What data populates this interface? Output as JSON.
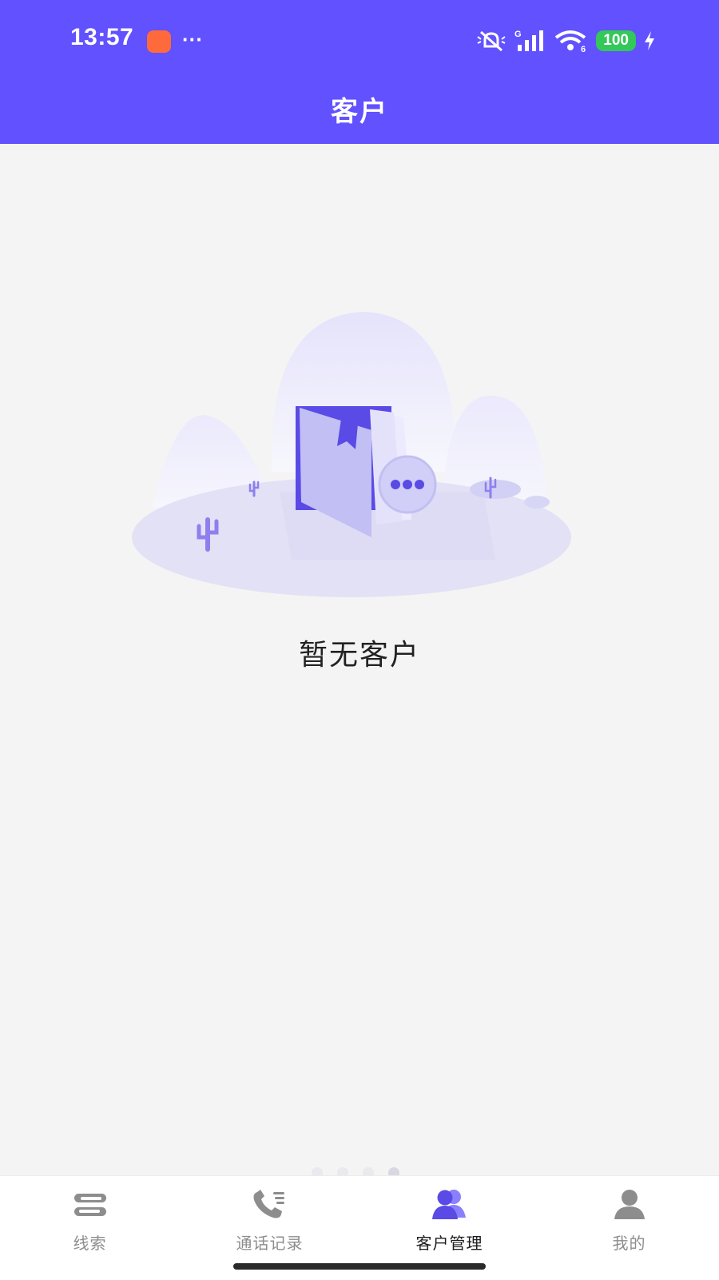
{
  "status_bar": {
    "time": "13:57",
    "notification_app_icon": "orange-shopping-app-icon",
    "more_indicator": "···",
    "icons": [
      "mute-icon",
      "signal-icon",
      "wifi-icon"
    ],
    "network_label": "G",
    "wifi_label": "6",
    "battery": "100",
    "charging_icon": "bolt-icon"
  },
  "header": {
    "title": "客户"
  },
  "empty_state": {
    "message": "暂无客户",
    "illustration": "empty-customers-illustration"
  },
  "tabbar": {
    "tabs": [
      {
        "label": "线索",
        "icon": "link-icon",
        "active": false
      },
      {
        "label": "通话记录",
        "icon": "call-log-icon",
        "active": false
      },
      {
        "label": "客户管理",
        "icon": "customers-icon",
        "active": true
      },
      {
        "label": "我的",
        "icon": "profile-icon",
        "active": false
      }
    ]
  },
  "colors": {
    "primary": "#6151ff",
    "background": "#f4f4f4",
    "tab_inactive": "#8d8d8d",
    "battery_green": "#34c759"
  }
}
